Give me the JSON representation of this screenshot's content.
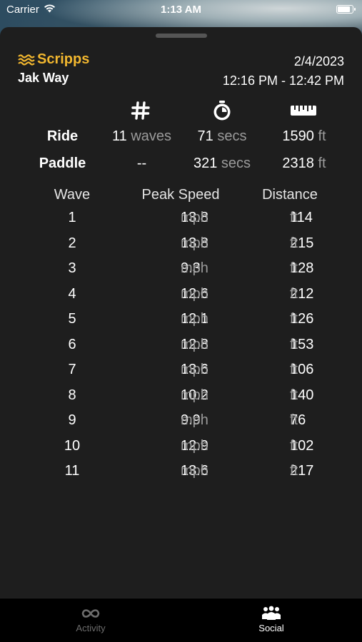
{
  "status_bar": {
    "carrier": "Carrier",
    "time": "1:13 AM"
  },
  "session": {
    "spot": "Scripps",
    "rider": "Jak Way",
    "date": "2/4/2023",
    "time_range": "12:16 PM - 12:42 PM"
  },
  "summary": {
    "ride": {
      "label": "Ride",
      "waves_value": "11",
      "waves_unit": "waves",
      "secs_value": "71",
      "secs_unit": "secs",
      "dist_value": "1590",
      "dist_unit": "ft"
    },
    "paddle": {
      "label": "Paddle",
      "waves_value": "--",
      "secs_value": "321",
      "secs_unit": "secs",
      "dist_value": "2318",
      "dist_unit": "ft"
    }
  },
  "waves_table": {
    "headers": {
      "wave": "Wave",
      "speed": "Peak Speed",
      "distance": "Distance"
    },
    "speed_unit": "mph",
    "distance_unit": "ft",
    "rows": [
      {
        "wave": "1",
        "speed": "13.8",
        "distance": "114"
      },
      {
        "wave": "2",
        "speed": "13.8",
        "distance": "215"
      },
      {
        "wave": "3",
        "speed": "9.3",
        "distance": "128"
      },
      {
        "wave": "4",
        "speed": "12.6",
        "distance": "212"
      },
      {
        "wave": "5",
        "speed": "12.1",
        "distance": "126"
      },
      {
        "wave": "6",
        "speed": "12.8",
        "distance": "153"
      },
      {
        "wave": "7",
        "speed": "13.6",
        "distance": "106"
      },
      {
        "wave": "8",
        "speed": "10.2",
        "distance": "140"
      },
      {
        "wave": "9",
        "speed": "9.9",
        "distance": "76"
      },
      {
        "wave": "10",
        "speed": "12.9",
        "distance": "102"
      },
      {
        "wave": "11",
        "speed": "13.6",
        "distance": "217"
      }
    ]
  },
  "tabbar": {
    "activity_label": "Activity",
    "social_label": "Social",
    "active_tab": "Social"
  },
  "colors": {
    "accent": "#f2b72f",
    "background": "#1e1e1e",
    "unit_gray": "#9b9b9b"
  }
}
